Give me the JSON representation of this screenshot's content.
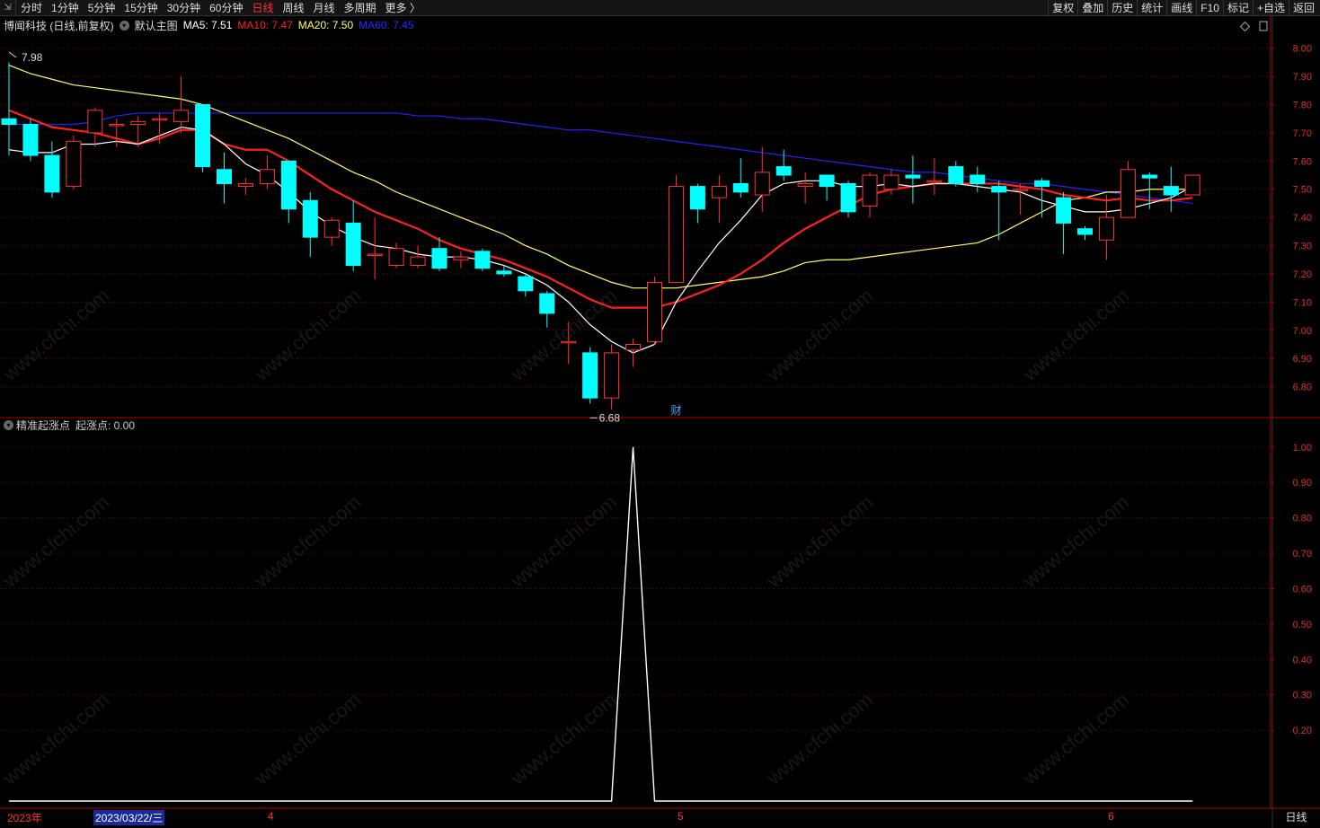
{
  "toolbar": {
    "corner_icon": "restore-icon",
    "tabs": [
      {
        "label": "分时",
        "active": false
      },
      {
        "label": "1分钟",
        "active": false
      },
      {
        "label": "5分钟",
        "active": false
      },
      {
        "label": "15分钟",
        "active": false
      },
      {
        "label": "30分钟",
        "active": false
      },
      {
        "label": "60分钟",
        "active": false
      },
      {
        "label": "日线",
        "active": true
      },
      {
        "label": "周线",
        "active": false
      },
      {
        "label": "月线",
        "active": false
      },
      {
        "label": "多周期",
        "active": false
      },
      {
        "label": "更多 〉",
        "active": false
      }
    ],
    "right_buttons": [
      "复权",
      "叠加",
      "历史",
      "统计",
      "画线",
      "F10",
      "标记",
      "+自选",
      "返回"
    ]
  },
  "main_panel": {
    "stock_name": "博闻科技 (日线,前复权)",
    "indicator_name": "默认主图",
    "ma5": "MA5: 7.51",
    "ma10": "MA10: 7.47",
    "ma20": "MA20: 7.50",
    "ma60": "MA60: 7.45",
    "high_marker": "7.98",
    "low_marker": "6.68",
    "event_marker": "财"
  },
  "sub_panel": {
    "indicator_name": "精准起涨点",
    "value_text": "起涨点: 0.00"
  },
  "date_axis": {
    "year": "2023年",
    "cursor_date": "2023/03/22/三",
    "months": [
      "4",
      "5",
      "6"
    ],
    "period": "日线"
  },
  "watermark": "www.cfchi.com",
  "colors": {
    "up": "#ff3333",
    "down": "#00ffff",
    "ma5": "#ffffff",
    "ma10": "#ff2020",
    "ma20": "#ffff66",
    "ma60": "#2222ff",
    "axis": "#b00000"
  },
  "chart_data": [
    {
      "type": "candlestick",
      "ylim": [
        6.7,
        8.05
      ],
      "y_ticks": [
        "8.00",
        "7.90",
        "7.80",
        "7.70",
        "7.60",
        "7.50",
        "7.40",
        "7.30",
        "7.20",
        "7.10",
        "7.00",
        "6.90",
        "6.80"
      ],
      "candles": [
        [
          7.75,
          7.73,
          7.95,
          7.62
        ],
        [
          7.73,
          7.62,
          7.75,
          7.6
        ],
        [
          7.62,
          7.49,
          7.67,
          7.47
        ],
        [
          7.51,
          7.67,
          7.69,
          7.5
        ],
        [
          7.7,
          7.78,
          7.79,
          7.65
        ],
        [
          7.73,
          7.73,
          7.75,
          7.65
        ],
        [
          7.73,
          7.74,
          7.76,
          7.65
        ],
        [
          7.75,
          7.75,
          7.77,
          7.66
        ],
        [
          7.74,
          7.78,
          7.9,
          7.7
        ],
        [
          7.8,
          7.58,
          7.8,
          7.56
        ],
        [
          7.57,
          7.52,
          7.63,
          7.45
        ],
        [
          7.51,
          7.52,
          7.54,
          7.48
        ],
        [
          7.52,
          7.57,
          7.62,
          7.5
        ],
        [
          7.6,
          7.43,
          7.6,
          7.38
        ],
        [
          7.46,
          7.33,
          7.49,
          7.26
        ],
        [
          7.33,
          7.39,
          7.4,
          7.3
        ],
        [
          7.38,
          7.23,
          7.46,
          7.21
        ],
        [
          7.27,
          7.27,
          7.4,
          7.18
        ],
        [
          7.23,
          7.29,
          7.31,
          7.22
        ],
        [
          7.23,
          7.26,
          7.3,
          7.22
        ],
        [
          7.29,
          7.22,
          7.33,
          7.21
        ],
        [
          7.25,
          7.26,
          7.28,
          7.22
        ],
        [
          7.28,
          7.22,
          7.29,
          7.21
        ],
        [
          7.21,
          7.2,
          7.23,
          7.19
        ],
        [
          7.19,
          7.14,
          7.2,
          7.12
        ],
        [
          7.13,
          7.06,
          7.14,
          7.01
        ],
        [
          6.96,
          6.96,
          7.03,
          6.88
        ],
        [
          6.92,
          6.76,
          6.94,
          6.74
        ],
        [
          6.76,
          6.92,
          6.95,
          6.72
        ],
        [
          6.93,
          6.95,
          6.97,
          6.87
        ],
        [
          6.96,
          7.17,
          7.19,
          6.95
        ],
        [
          7.17,
          7.51,
          7.55,
          7.17
        ],
        [
          7.51,
          7.43,
          7.52,
          7.38
        ],
        [
          7.47,
          7.51,
          7.55,
          7.38
        ],
        [
          7.52,
          7.49,
          7.61,
          7.47
        ],
        [
          7.48,
          7.56,
          7.65,
          7.42
        ],
        [
          7.58,
          7.55,
          7.64,
          7.53
        ],
        [
          7.51,
          7.52,
          7.56,
          7.45
        ],
        [
          7.55,
          7.51,
          7.55,
          7.46
        ],
        [
          7.52,
          7.42,
          7.53,
          7.4
        ],
        [
          7.44,
          7.55,
          7.56,
          7.4
        ],
        [
          7.5,
          7.55,
          7.57,
          7.48
        ],
        [
          7.55,
          7.54,
          7.62,
          7.45
        ],
        [
          7.53,
          7.53,
          7.61,
          7.48
        ],
        [
          7.58,
          7.52,
          7.6,
          7.51
        ],
        [
          7.55,
          7.52,
          7.58,
          7.49
        ],
        [
          7.51,
          7.49,
          7.53,
          7.32
        ],
        [
          7.5,
          7.5,
          7.52,
          7.41
        ],
        [
          7.53,
          7.51,
          7.54,
          7.4
        ],
        [
          7.47,
          7.38,
          7.49,
          7.27
        ],
        [
          7.36,
          7.34,
          7.37,
          7.32
        ],
        [
          7.32,
          7.4,
          7.48,
          7.25
        ],
        [
          7.4,
          7.57,
          7.6,
          7.4
        ],
        [
          7.55,
          7.54,
          7.56,
          7.43
        ],
        [
          7.51,
          7.48,
          7.58,
          7.42
        ],
        [
          7.48,
          7.55,
          7.55,
          7.48
        ]
      ],
      "ma5": [
        7.64,
        7.63,
        7.63,
        7.66,
        7.66,
        7.67,
        7.66,
        7.69,
        7.72,
        7.71,
        7.66,
        7.59,
        7.55,
        7.49,
        7.42,
        7.37,
        7.33,
        7.3,
        7.29,
        7.27,
        7.26,
        7.26,
        7.25,
        7.23,
        7.2,
        7.16,
        7.1,
        7.02,
        6.96,
        6.92,
        6.95,
        7.1,
        7.21,
        7.31,
        7.39,
        7.48,
        7.52,
        7.53,
        7.53,
        7.51,
        7.51,
        7.52,
        7.51,
        7.52,
        7.52,
        7.51,
        7.5,
        7.49,
        7.46,
        7.44,
        7.42,
        7.42,
        7.43,
        7.45,
        7.47,
        7.51
      ],
      "ma10": [
        7.78,
        7.75,
        7.72,
        7.71,
        7.7,
        7.68,
        7.66,
        7.68,
        7.71,
        7.71,
        7.66,
        7.64,
        7.64,
        7.6,
        7.55,
        7.5,
        7.46,
        7.42,
        7.39,
        7.36,
        7.32,
        7.29,
        7.27,
        7.25,
        7.22,
        7.19,
        7.15,
        7.11,
        7.08,
        7.08,
        7.08,
        7.1,
        7.13,
        7.16,
        7.2,
        7.25,
        7.31,
        7.36,
        7.4,
        7.44,
        7.48,
        7.5,
        7.51,
        7.52,
        7.52,
        7.52,
        7.52,
        7.51,
        7.5,
        7.48,
        7.47,
        7.46,
        7.47,
        7.46,
        7.46,
        7.47
      ],
      "ma20": [
        7.94,
        7.91,
        7.89,
        7.87,
        7.86,
        7.85,
        7.84,
        7.83,
        7.82,
        7.8,
        7.77,
        7.74,
        7.71,
        7.68,
        7.64,
        7.6,
        7.56,
        7.53,
        7.49,
        7.46,
        7.43,
        7.4,
        7.37,
        7.34,
        7.3,
        7.27,
        7.23,
        7.2,
        7.17,
        7.15,
        7.15,
        7.15,
        7.16,
        7.17,
        7.18,
        7.19,
        7.21,
        7.24,
        7.25,
        7.25,
        7.26,
        7.27,
        7.28,
        7.29,
        7.3,
        7.31,
        7.34,
        7.38,
        7.42,
        7.46,
        7.47,
        7.49,
        7.49,
        7.5,
        7.5,
        7.5
      ],
      "ma60": [
        7.73,
        7.73,
        7.73,
        7.73,
        7.74,
        7.76,
        7.77,
        7.77,
        7.77,
        7.77,
        7.77,
        7.77,
        7.77,
        7.77,
        7.77,
        7.77,
        7.77,
        7.77,
        7.77,
        7.76,
        7.76,
        7.75,
        7.75,
        7.74,
        7.73,
        7.72,
        7.71,
        7.71,
        7.7,
        7.69,
        7.68,
        7.67,
        7.66,
        7.65,
        7.64,
        7.63,
        7.62,
        7.61,
        7.6,
        7.59,
        7.58,
        7.57,
        7.56,
        7.56,
        7.55,
        7.54,
        7.53,
        7.52,
        7.52,
        7.51,
        7.5,
        7.49,
        7.48,
        7.47,
        7.46,
        7.45
      ]
    },
    {
      "type": "line",
      "name": "起涨点",
      "ylim": [
        0,
        1.04
      ],
      "y_ticks": [
        "1.00",
        "0.90",
        "0.80",
        "0.70",
        "0.60",
        "0.50",
        "0.40",
        "0.30",
        "0.20"
      ],
      "values": [
        0,
        0,
        0,
        0,
        0,
        0,
        0,
        0,
        0,
        0,
        0,
        0,
        0,
        0,
        0,
        0,
        0,
        0,
        0,
        0,
        0,
        0,
        0,
        0,
        0,
        0,
        0,
        0,
        0,
        1,
        0,
        0,
        0,
        0,
        0,
        0,
        0,
        0,
        0,
        0,
        0,
        0,
        0,
        0,
        0,
        0,
        0,
        0,
        0,
        0,
        0,
        0,
        0,
        0,
        0,
        0
      ]
    }
  ]
}
